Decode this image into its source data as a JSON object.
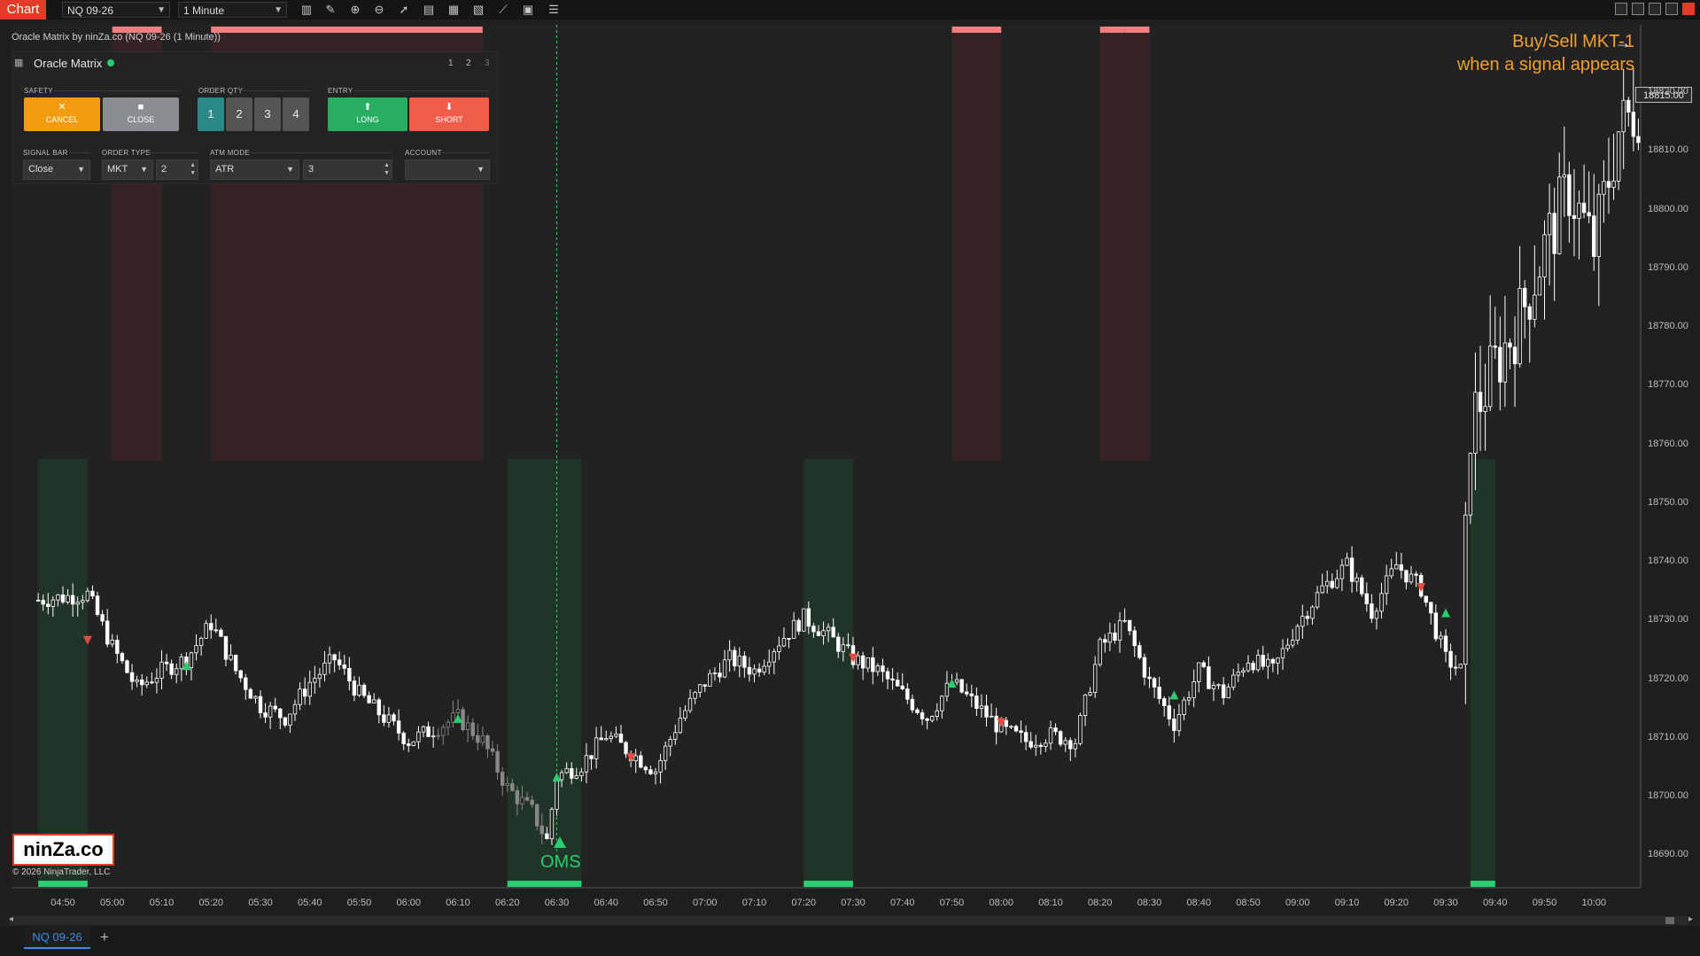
{
  "toolbar": {
    "chart_label": "Chart",
    "instrument": "NQ 09-26",
    "interval": "1 Minute"
  },
  "indicator_label": "Oracle Matrix by ninZa.co (NQ 09-26 (1 Minute))",
  "panel": {
    "title": "Oracle Matrix",
    "pages": [
      "1",
      "2",
      "3"
    ],
    "safety_label": "SAFETY",
    "cancel_label": "CANCEL",
    "close_label": "CLOSE",
    "order_qty_label": "ORDER QTY",
    "qty_buttons": [
      "1",
      "2",
      "3",
      "4"
    ],
    "entry_label": "ENTRY",
    "long_label": "LONG",
    "short_label": "SHORT",
    "signal_bar_label": "SIGNAL BAR",
    "signal_bar_value": "Close",
    "order_type_label": "ORDER TYPE",
    "order_type_value": "MKT",
    "order_type_offset": "2",
    "atm_mode_label": "ATM MODE",
    "atm_mode_value": "ATR",
    "atm_mode_param": "3",
    "account_label": "ACCOUNT",
    "account_value": ""
  },
  "annotation": {
    "line1": "Buy/Sell MKT-1",
    "line2": "when a signal appears"
  },
  "oms_label": "OMS",
  "current_price": "18815.00",
  "logo_text": "ninZa.co",
  "copyright": "© 2026 NinjaTrader, LLC",
  "bottom_tab": "NQ 09-26",
  "add_tab": "+",
  "colors": {
    "accent_red": "#e03c28",
    "long_green": "#2ecc71",
    "short_red": "#e74c3c",
    "cancel_orange": "#f39c12",
    "annotation_orange": "#f0a030"
  },
  "chart_data": {
    "type": "candlestick",
    "x_ticks": [
      "04:50",
      "05:00",
      "05:10",
      "05:20",
      "05:30",
      "05:40",
      "05:50",
      "06:00",
      "06:10",
      "06:20",
      "06:30",
      "06:40",
      "06:50",
      "07:00",
      "07:10",
      "07:20",
      "07:30",
      "07:40",
      "07:50",
      "08:00",
      "08:10",
      "08:20",
      "08:30",
      "08:40",
      "08:50",
      "09:00",
      "09:10",
      "09:20",
      "09:30",
      "09:40",
      "09:50",
      "10:00"
    ],
    "y_ticks": [
      "18690.00",
      "18700.00",
      "18710.00",
      "18720.00",
      "18730.00",
      "18740.00",
      "18750.00",
      "18760.00",
      "18770.00",
      "18780.00",
      "18790.00",
      "18800.00",
      "18810.00",
      "18820.00"
    ],
    "ylim": [
      18681,
      18828
    ],
    "close_path": [
      [
        "04:45",
        18730
      ],
      [
        "04:55",
        18731
      ],
      [
        "05:00",
        18722
      ],
      [
        "05:05",
        18715
      ],
      [
        "05:10",
        18718
      ],
      [
        "05:15",
        18720
      ],
      [
        "05:20",
        18726
      ],
      [
        "05:25",
        18718
      ],
      [
        "05:30",
        18712
      ],
      [
        "05:35",
        18710
      ],
      [
        "05:40",
        18716
      ],
      [
        "05:45",
        18720
      ],
      [
        "05:50",
        18714
      ],
      [
        "05:55",
        18710
      ],
      [
        "06:00",
        18706
      ],
      [
        "06:05",
        18708
      ],
      [
        "06:10",
        18710
      ],
      [
        "06:15",
        18706
      ],
      [
        "06:20",
        18698
      ],
      [
        "06:25",
        18694
      ],
      [
        "06:28",
        18689
      ],
      [
        "06:30",
        18700
      ],
      [
        "06:35",
        18702
      ],
      [
        "06:40",
        18707
      ],
      [
        "06:45",
        18704
      ],
      [
        "06:50",
        18701
      ],
      [
        "06:55",
        18710
      ],
      [
        "07:00",
        18716
      ],
      [
        "07:05",
        18720
      ],
      [
        "07:10",
        18718
      ],
      [
        "07:15",
        18723
      ],
      [
        "07:20",
        18727
      ],
      [
        "07:25",
        18724
      ],
      [
        "07:30",
        18720
      ],
      [
        "07:35",
        18718
      ],
      [
        "07:40",
        18714
      ],
      [
        "07:45",
        18710
      ],
      [
        "07:50",
        18716
      ],
      [
        "07:55",
        18712
      ],
      [
        "08:00",
        18708
      ],
      [
        "08:05",
        18706
      ],
      [
        "08:10",
        18707
      ],
      [
        "08:15",
        18706
      ],
      [
        "08:20",
        18722
      ],
      [
        "08:25",
        18726
      ],
      [
        "08:30",
        18716
      ],
      [
        "08:35",
        18709
      ],
      [
        "08:40",
        18718
      ],
      [
        "08:45",
        18714
      ],
      [
        "08:50",
        18720
      ],
      [
        "08:55",
        18718
      ],
      [
        "09:00",
        18726
      ],
      [
        "09:05",
        18732
      ],
      [
        "09:10",
        18736
      ],
      [
        "09:15",
        18728
      ],
      [
        "09:20",
        18736
      ],
      [
        "09:25",
        18732
      ],
      [
        "09:30",
        18720
      ],
      [
        "09:33",
        18718
      ],
      [
        "09:35",
        18760
      ],
      [
        "09:40",
        18770
      ],
      [
        "09:45",
        18778
      ],
      [
        "09:50",
        18790
      ],
      [
        "09:55",
        18800
      ],
      [
        "10:00",
        18790
      ],
      [
        "10:05",
        18810
      ],
      [
        "10:10",
        18815
      ]
    ],
    "buy_signals": [
      [
        "05:15",
        18719
      ],
      [
        "06:10",
        18710
      ],
      [
        "06:30",
        18700
      ],
      [
        "07:50",
        18716
      ],
      [
        "08:35",
        18714
      ],
      [
        "09:30",
        18728
      ]
    ],
    "sell_signals": [
      [
        "04:55",
        18723
      ],
      [
        "06:45",
        18703
      ],
      [
        "07:30",
        18720
      ],
      [
        "08:00",
        18709
      ],
      [
        "09:25",
        18732
      ]
    ],
    "long_zones": [
      [
        "04:45",
        "04:55"
      ],
      [
        "06:20",
        "06:35"
      ],
      [
        "07:20",
        "07:30"
      ],
      [
        "09:35",
        "09:40"
      ]
    ],
    "short_zones": [
      [
        "05:00",
        "05:10"
      ],
      [
        "05:20",
        "06:15"
      ],
      [
        "07:50",
        "08:00"
      ],
      [
        "08:20",
        "08:25"
      ],
      [
        "08:25",
        "08:30"
      ]
    ],
    "signal_line_time": "06:30"
  }
}
